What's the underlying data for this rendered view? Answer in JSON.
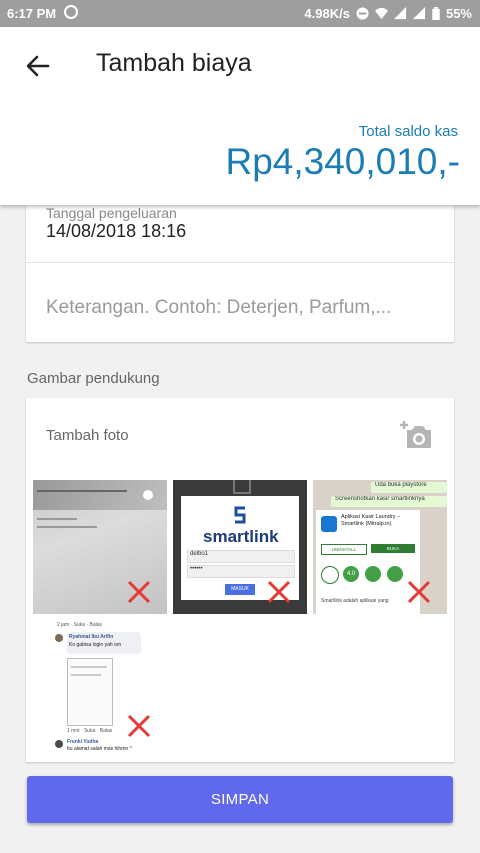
{
  "status_bar": {
    "time": "6:17 PM",
    "network_speed": "4.98K/s",
    "battery": "55%"
  },
  "header": {
    "title": "Tambah biaya",
    "saldo_label": "Total saldo kas",
    "saldo_value": "Rp4,340,010,-"
  },
  "form": {
    "date_label": "Tanggal pengeluaran",
    "date_value": "14/08/2018 18:16",
    "description_placeholder": "Keterangan. Contoh: Deterjen, Parfum,..."
  },
  "attachments": {
    "section_label": "Gambar pendukung",
    "add_photo_label": "Tambah foto",
    "photos": [
      {
        "description": ""
      },
      {
        "logo_text": "smartlink",
        "field_username": "delbo1",
        "field_password": "••••••",
        "button_label": "MASUK"
      },
      {
        "top_text_1": "Uda buka playstore",
        "top_text_2": "Screenshotkan kasir smartlinknya",
        "app_name": "Aplikasi Kasir Laundry – Smartlink (Mitralp.in)",
        "btn_left": "UNINSTALL",
        "btn_right": "BUKA",
        "rating": "4.0",
        "footer": "Smartlink adalah aplikasi yang"
      },
      {
        "row1": "2 jam · Suka · Balas",
        "name1": "Ryahmat Ibu Arifin",
        "text1": "Ko gabisa login yah om",
        "row2": "1 mnt · Suka · Balas",
        "name2": "Frenki Yudha",
        "text2": "Itu alamat salah mas hihmo ^"
      }
    ]
  },
  "actions": {
    "save_label": "SIMPAN"
  },
  "colors": {
    "accent_blue": "#1b7db3",
    "save_button": "#6069eb",
    "remove_x": "#e53935"
  }
}
